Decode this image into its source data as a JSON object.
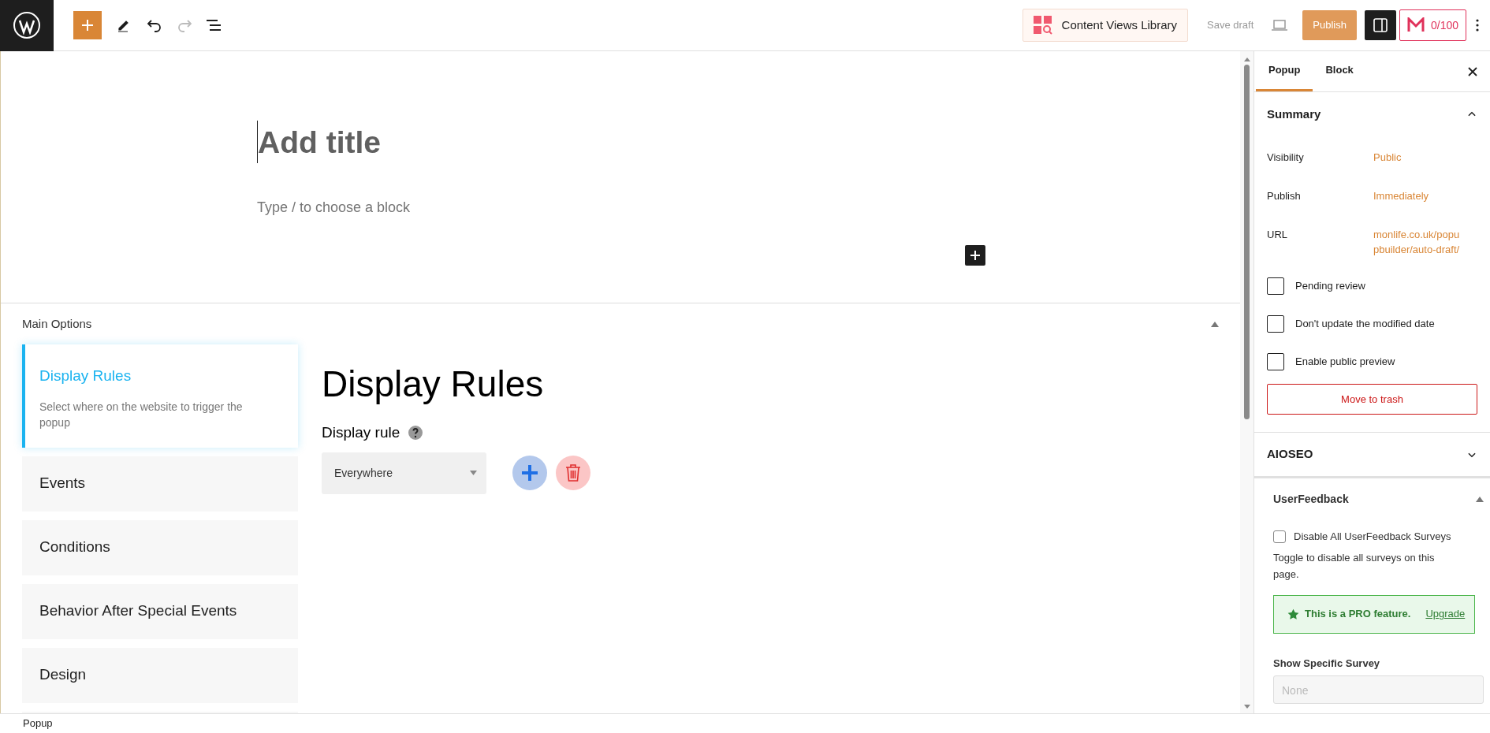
{
  "toolbar": {
    "library_button": "Content Views Library",
    "save_draft": "Save draft",
    "publish": "Publish",
    "score": "0/100"
  },
  "editor": {
    "title_placeholder": "Add title",
    "block_placeholder": "Type / to choose a block"
  },
  "main_options": {
    "title": "Main Options",
    "expanded": true,
    "tabs": [
      {
        "label": "Display Rules",
        "description": "Select where on the website to trigger the popup",
        "selected": true
      },
      {
        "label": "Events",
        "selected": false
      },
      {
        "label": "Conditions",
        "selected": false
      },
      {
        "label": "Behavior After Special Events",
        "selected": false
      },
      {
        "label": "Design",
        "selected": false
      }
    ],
    "panel": {
      "heading": "Display Rules",
      "rule_label": "Display rule",
      "rule_value": "Everywhere"
    }
  },
  "sidebar": {
    "tabs": [
      {
        "label": "Popup",
        "selected": true
      },
      {
        "label": "Block",
        "selected": false
      }
    ],
    "summary": {
      "title": "Summary",
      "expanded": true,
      "rows": [
        {
          "label": "Visibility",
          "value": "Public"
        },
        {
          "label": "Publish",
          "value": "Immediately"
        },
        {
          "label": "URL",
          "value": "monlife.co.uk/popupbuilder/auto-draft/"
        }
      ],
      "checkboxes": [
        {
          "label": "Pending review",
          "checked": false
        },
        {
          "label": "Don't update the modified date",
          "checked": false
        },
        {
          "label": "Enable public preview",
          "checked": false
        }
      ],
      "trash_button": "Move to trash"
    },
    "aioseo": {
      "title": "AIOSEO",
      "expanded": false
    },
    "userfeedback": {
      "title": "UserFeedback",
      "expanded": true,
      "checkbox": {
        "label": "Disable All UserFeedback Surveys",
        "checked": false
      },
      "help": "Toggle to disable all surveys on this page.",
      "pro_notice": "This is a PRO feature.",
      "upgrade_link": "Upgrade",
      "survey_label": "Show Specific Survey",
      "survey_placeholder": "None"
    }
  },
  "status_bar": {
    "breadcrumb": "Popup"
  }
}
